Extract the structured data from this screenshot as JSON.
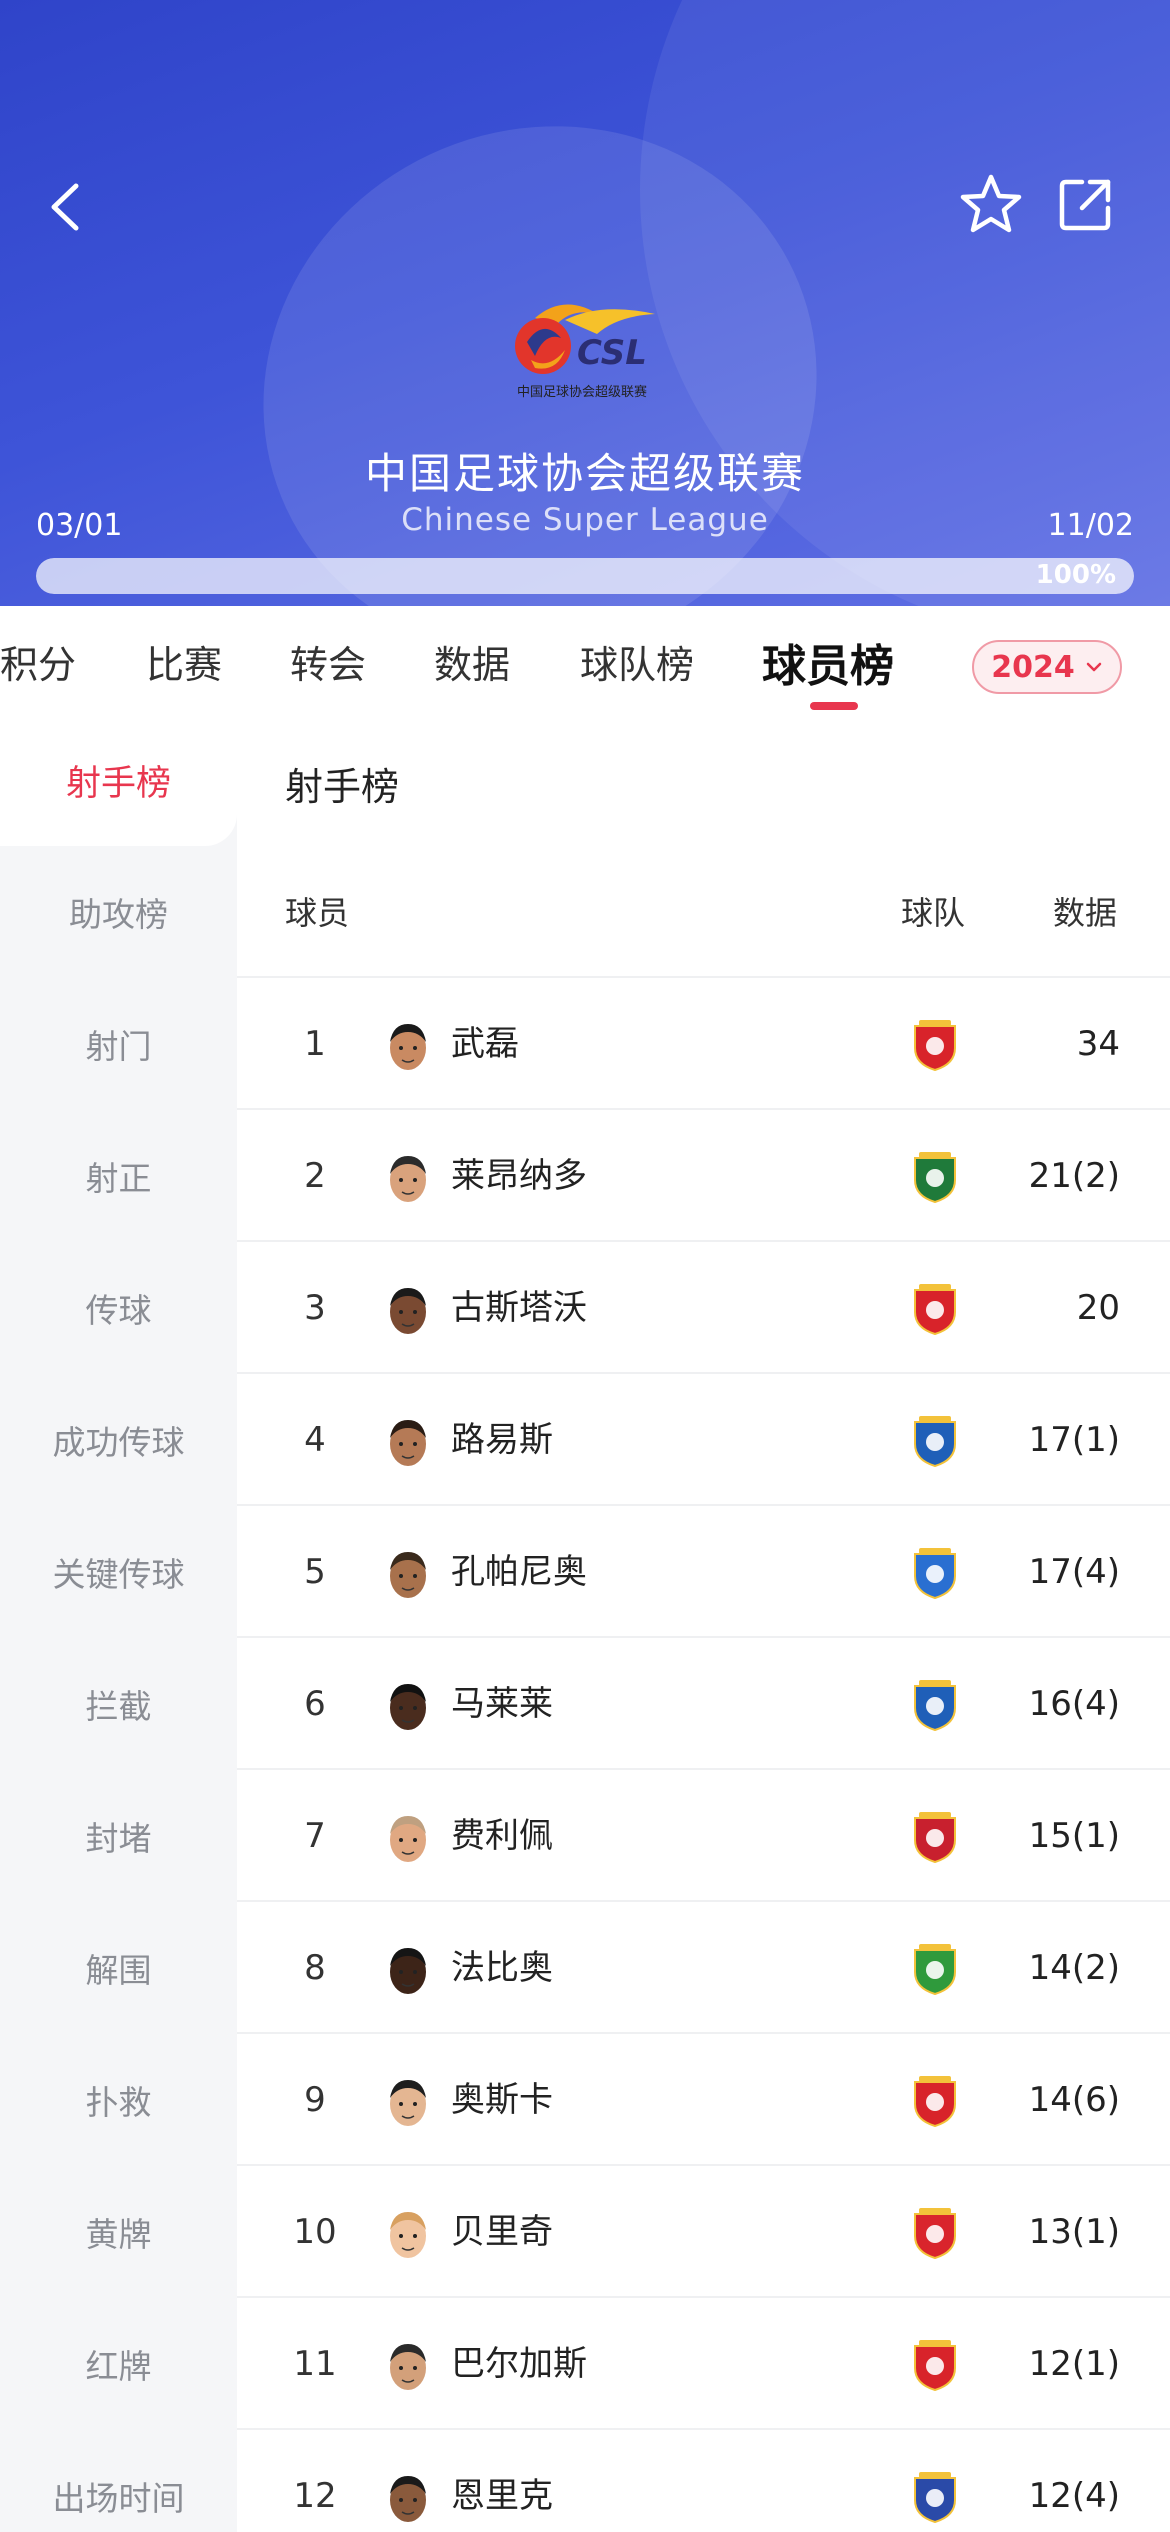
{
  "league": {
    "name_cn": "中国足球协会超级联赛",
    "name_en": "Chinese Super League",
    "logo_text": "CSL",
    "logo_subtext": "中国足球协会超级联赛",
    "start_date": "03/01",
    "end_date": "11/02",
    "progress_label": "100%",
    "progress_fraction": 1.0
  },
  "tabs": [
    {
      "label": "积分"
    },
    {
      "label": "比赛"
    },
    {
      "label": "转会"
    },
    {
      "label": "数据"
    },
    {
      "label": "球队榜"
    },
    {
      "label": "球员榜"
    }
  ],
  "active_tab": "球员榜",
  "season": {
    "label": "2024"
  },
  "sidebar": {
    "items": [
      {
        "label": "射手榜"
      },
      {
        "label": "助攻榜"
      },
      {
        "label": "射门"
      },
      {
        "label": "射正"
      },
      {
        "label": "传球"
      },
      {
        "label": "成功传球"
      },
      {
        "label": "关键传球"
      },
      {
        "label": "拦截"
      },
      {
        "label": "封堵"
      },
      {
        "label": "解围"
      },
      {
        "label": "扑救"
      },
      {
        "label": "黄牌"
      },
      {
        "label": "红牌"
      },
      {
        "label": "出场时间"
      }
    ]
  },
  "table": {
    "title": "射手榜",
    "headers": {
      "player": "球员",
      "team": "球队",
      "data": "数据"
    },
    "rows": [
      {
        "rank": "1",
        "name": "武磊",
        "stat": "34",
        "team_icon": "shanghai-port-badge",
        "team_color": "#d8232a"
      },
      {
        "rank": "2",
        "name": "莱昂纳多",
        "stat": "21(2)",
        "team_icon": "zhejiang-badge",
        "team_color": "#1f7a3a"
      },
      {
        "rank": "3",
        "name": "古斯塔沃",
        "stat": "20",
        "team_icon": "shanghai-port-badge",
        "team_color": "#d8232a"
      },
      {
        "rank": "4",
        "name": "路易斯",
        "stat": "17(1)",
        "team_icon": "shanghai-shenhua-badge",
        "team_color": "#1f5fb8"
      },
      {
        "rank": "5",
        "name": "孔帕尼奥",
        "stat": "17(4)",
        "team_icon": "shandong-taishan-badge",
        "team_color": "#2a6fd1"
      },
      {
        "rank": "6",
        "name": "马莱莱",
        "stat": "16(4)",
        "team_icon": "shanghai-shenhua-badge",
        "team_color": "#1f5fb8"
      },
      {
        "rank": "7",
        "name": "费利佩",
        "stat": "15(1)",
        "team_icon": "chengdu-rongcheng-badge",
        "team_color": "#c8202e"
      },
      {
        "rank": "8",
        "name": "法比奥",
        "stat": "14(2)",
        "team_icon": "beijing-guoan-badge",
        "team_color": "#2f9a3c"
      },
      {
        "rank": "9",
        "name": "奥斯卡",
        "stat": "14(6)",
        "team_icon": "shanghai-port-badge",
        "team_color": "#d8232a"
      },
      {
        "rank": "10",
        "name": "贝里奇",
        "stat": "13(1)",
        "team_icon": "changchun-yatai-badge",
        "team_color": "#d9242c"
      },
      {
        "rank": "11",
        "name": "巴尔加斯",
        "stat": "12(1)",
        "team_icon": "shanghai-port-badge",
        "team_color": "#d8232a"
      },
      {
        "rank": "12",
        "name": "恩里克",
        "stat": "12(4)",
        "team_icon": "wuhan-threetowns-badge",
        "team_color": "#2a4aa8"
      }
    ]
  },
  "colors": {
    "accent": "#e8364e",
    "header_start": "#2f44c9",
    "header_end": "#6170e4",
    "sidebar_bg": "#f5f6f8"
  }
}
